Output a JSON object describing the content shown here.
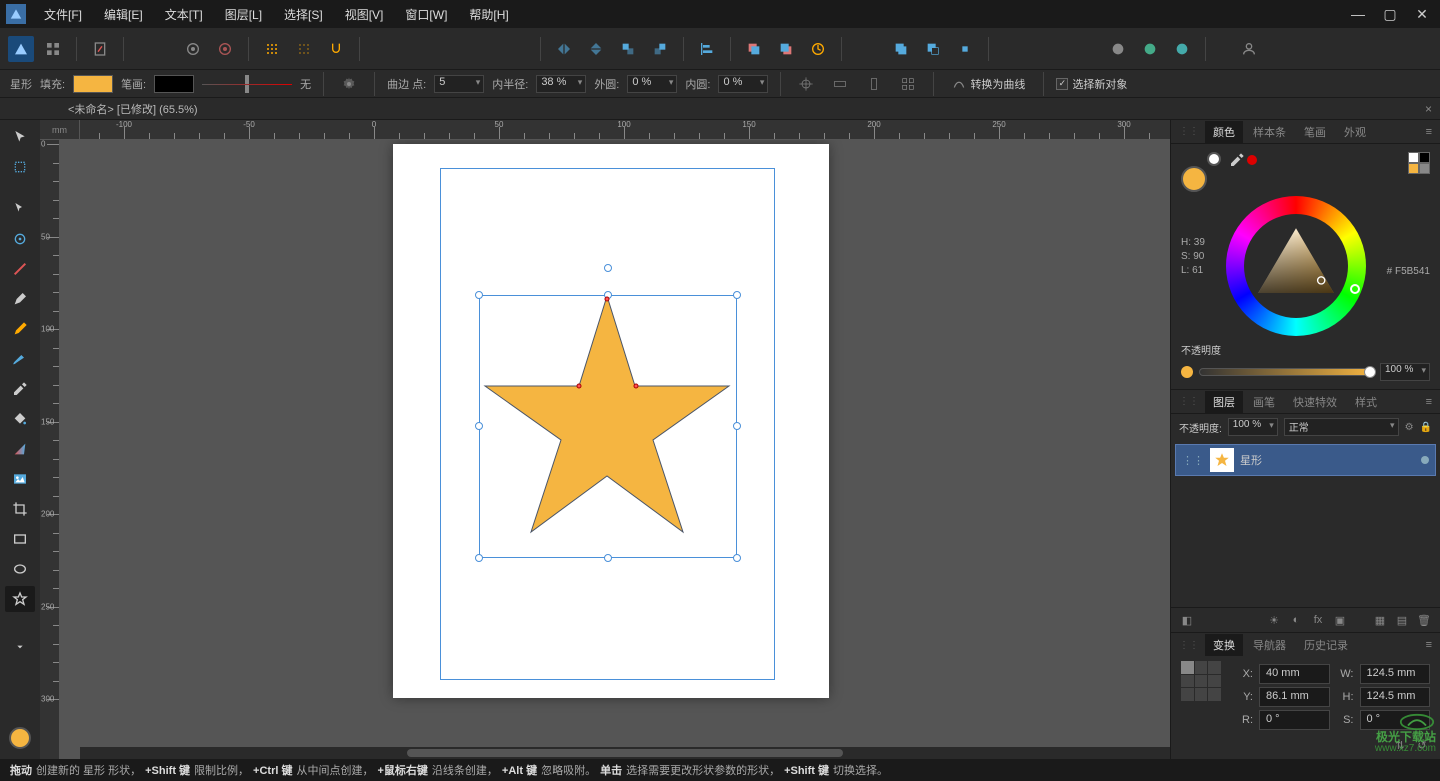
{
  "menu": {
    "file": "文件[F]",
    "edit": "编辑[E]",
    "text": "文本[T]",
    "layer": "图层[L]",
    "select": "选择[S]",
    "view": "视图[V]",
    "window": "窗口[W]",
    "help": "帮助[H]"
  },
  "doc_tab": {
    "title": "<未命名> [已修改] (65.5%)"
  },
  "context": {
    "tool_name": "星形",
    "fill_label": "填充:",
    "stroke_label": "笔画:",
    "stroke_none": "无",
    "curve_label": "曲边 点:",
    "curve_val": "5",
    "inner_label": "内半径:",
    "inner_val": "38 %",
    "outer_circle_label": "外圆:",
    "outer_circle_val": "0 %",
    "inner_circle_label": "内圆:",
    "inner_circle_val": "0 %",
    "to_curves": "转换为曲线",
    "select_new": "选择新对象"
  },
  "ruler_unit": "mm",
  "panels": {
    "color": {
      "tab1": "颜色",
      "tab2": "样本条",
      "tab3": "笔画",
      "tab4": "外观",
      "h": "H: 39",
      "s": "S: 90",
      "l": "L: 61",
      "hex": "F5B541",
      "hash": "#",
      "opacity_label": "不透明度",
      "opacity_val": "100 %"
    },
    "layers": {
      "tab1": "图层",
      "tab2": "画笔",
      "tab3": "快速特效",
      "tab4": "样式",
      "opacity_label": "不透明度:",
      "opacity_val": "100 %",
      "blend": "正常",
      "layer_name": "星形"
    },
    "transform": {
      "tab1": "变换",
      "tab2": "导航器",
      "tab3": "历史记录",
      "x_label": "X:",
      "x_val": "40 mm",
      "w_label": "W:",
      "w_val": "124.5 mm",
      "y_label": "Y:",
      "y_val": "86.1 mm",
      "h_label": "H:",
      "h_val": "124.5 mm",
      "r_label": "R:",
      "r_val": "0 °",
      "s_label": "S:",
      "s_val": "0 °"
    }
  },
  "status": {
    "drag_b": "拖动",
    "drag_t": " 创建新的 星形 形状，",
    "shift_b": "+Shift 键",
    "shift_t": " 限制比例，",
    "ctrl_b": "+Ctrl 键",
    "ctrl_t": " 从中间点创建，",
    "rmb_b": "+鼠标右键",
    "rmb_t": " 沿线条创建，",
    "alt_b": "+Alt 键",
    "alt_t": " 忽略吸附。",
    "click_b": "单击",
    "click_t": " 选择需要更改形状参数的形状，",
    "shift2_b": "+Shift 键",
    "shift2_t": " 切换选择。"
  },
  "watermark": {
    "brand": "极光下载站",
    "url": "www.xz7.com"
  }
}
